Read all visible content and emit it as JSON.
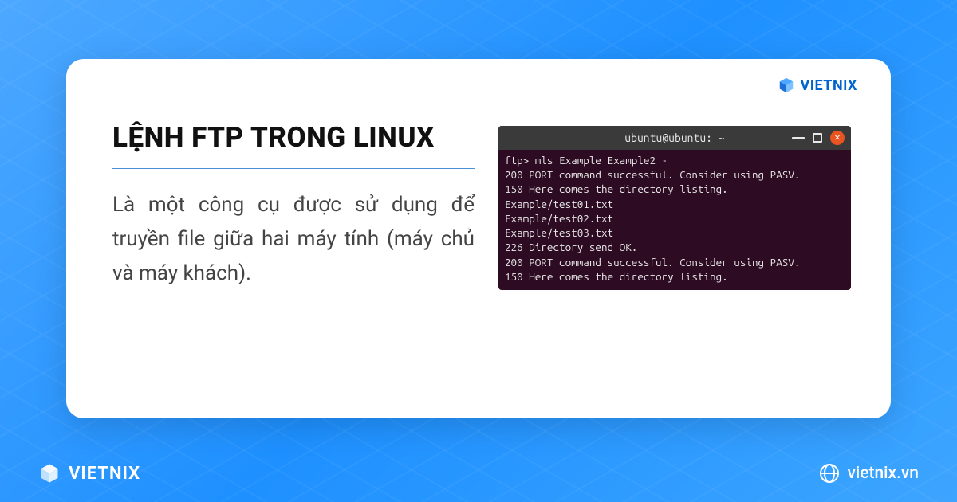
{
  "brand": {
    "name": "VIETNIX",
    "site": "vietnix.vn"
  },
  "card": {
    "title": "LỆNH FTP TRONG LINUX",
    "description": "Là một công cụ được sử dụng để truyền file giữa hai máy tính (máy chủ và máy khách)."
  },
  "terminal": {
    "title": "ubuntu@ubuntu: ~",
    "lines": "ftp> mls Example Example2 -\n200 PORT command successful. Consider using PASV.\n150 Here comes the directory listing.\nExample/test01.txt\nExample/test02.txt\nExample/test03.txt\n226 Directory send OK.\n200 PORT command successful. Consider using PASV.\n150 Here comes the directory listing."
  },
  "colors": {
    "accent": "#1e90ff",
    "terminal_bg": "#2d0b22",
    "close_btn": "#e95420"
  }
}
